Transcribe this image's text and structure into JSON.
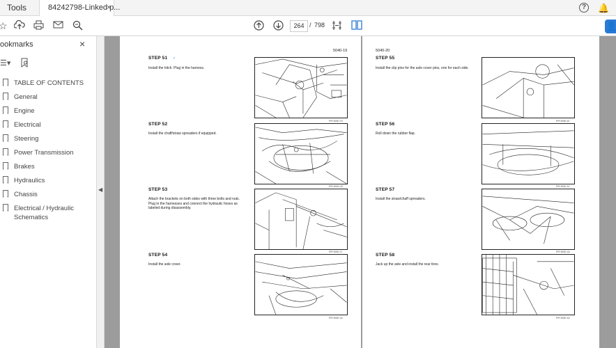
{
  "tabs": {
    "tools": "Tools",
    "document": "84242798-Linked p...",
    "close": "×"
  },
  "toolbar": {
    "page_current": "264",
    "page_separator": "/",
    "page_total": "798"
  },
  "sidebar": {
    "title": "ookmarks",
    "close": "×",
    "items": [
      {
        "label": "TABLE OF CONTENTS"
      },
      {
        "label": "General"
      },
      {
        "label": "Engine"
      },
      {
        "label": "Electrical"
      },
      {
        "label": "Steering"
      },
      {
        "label": "Power Transmission"
      },
      {
        "label": "Brakes"
      },
      {
        "label": "Hydraulics"
      },
      {
        "label": "Chassis"
      },
      {
        "label": "Electrical / Hydraulic"
      },
      {
        "label": "Schematics"
      }
    ]
  },
  "left_page": {
    "number": "5040-19",
    "steps": [
      {
        "title": "STEP  51",
        "text": "Install the hitch. Plug in the harness.",
        "code": "FR+0000 YZ"
      },
      {
        "title": "STEP  52",
        "text": "Install the chaff/straw spreaders if equipped.",
        "code": "FR+0000 UZ"
      },
      {
        "title": "STEP  53",
        "text": "Attach the brackets on both sides with three bolts and nuts. Plug in the harnesses and connect the hydraulic hoses as labeled during disassembly.",
        "code": "FR+0000 17"
      },
      {
        "title": "STEP  54",
        "text": "Install the axle cover.",
        "code": "FR+0000 1A"
      }
    ]
  },
  "right_page": {
    "number": "5040-20",
    "steps": [
      {
        "title": "STEP  55",
        "text": "Install the clip pins for the axle cover pins, one for each side.",
        "code": "FR+0000 10"
      },
      {
        "title": "STEP  56",
        "text": "Roll down the rubber flap.",
        "code": "FR+0000 10"
      },
      {
        "title": "STEP  57",
        "text": "Install the straw/chaff spreaders.",
        "code": "FR+0000 1A"
      },
      {
        "title": "STEP  58",
        "text": "Jack up the axle and install the rear tires.",
        "code": "FR+0000 1D"
      }
    ]
  }
}
